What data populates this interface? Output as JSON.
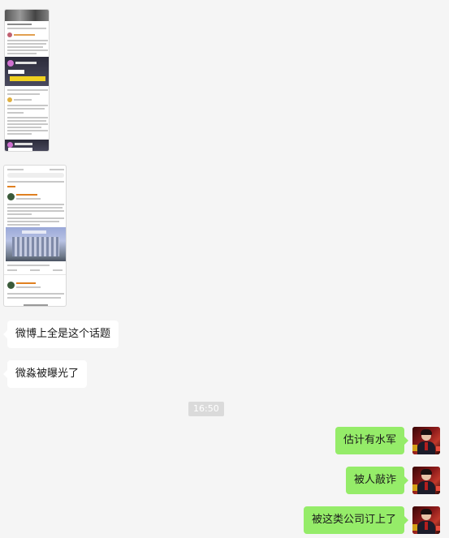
{
  "messages": [
    {
      "side": "left",
      "type": "image",
      "thumb": "weibo-feed-screenshot-1"
    },
    {
      "side": "left",
      "type": "image",
      "thumb": "weibo-feed-screenshot-2"
    },
    {
      "side": "left",
      "type": "text",
      "text": "微博上全是这个话题"
    },
    {
      "side": "left",
      "type": "text",
      "text": "微淼被曝光了"
    },
    {
      "type": "time",
      "text": "16:50"
    },
    {
      "side": "right",
      "type": "text",
      "text": "估计有水军"
    },
    {
      "side": "right",
      "type": "text",
      "text": "被人敲诈"
    },
    {
      "side": "right",
      "type": "text",
      "text": "被这类公司订上了"
    }
  ],
  "colors": {
    "background": "#f5f5f5",
    "bubble_left": "#ffffff",
    "bubble_right": "#95ec69",
    "time_badge": "#dadada"
  },
  "icons": {
    "avatar": "user-avatar"
  }
}
